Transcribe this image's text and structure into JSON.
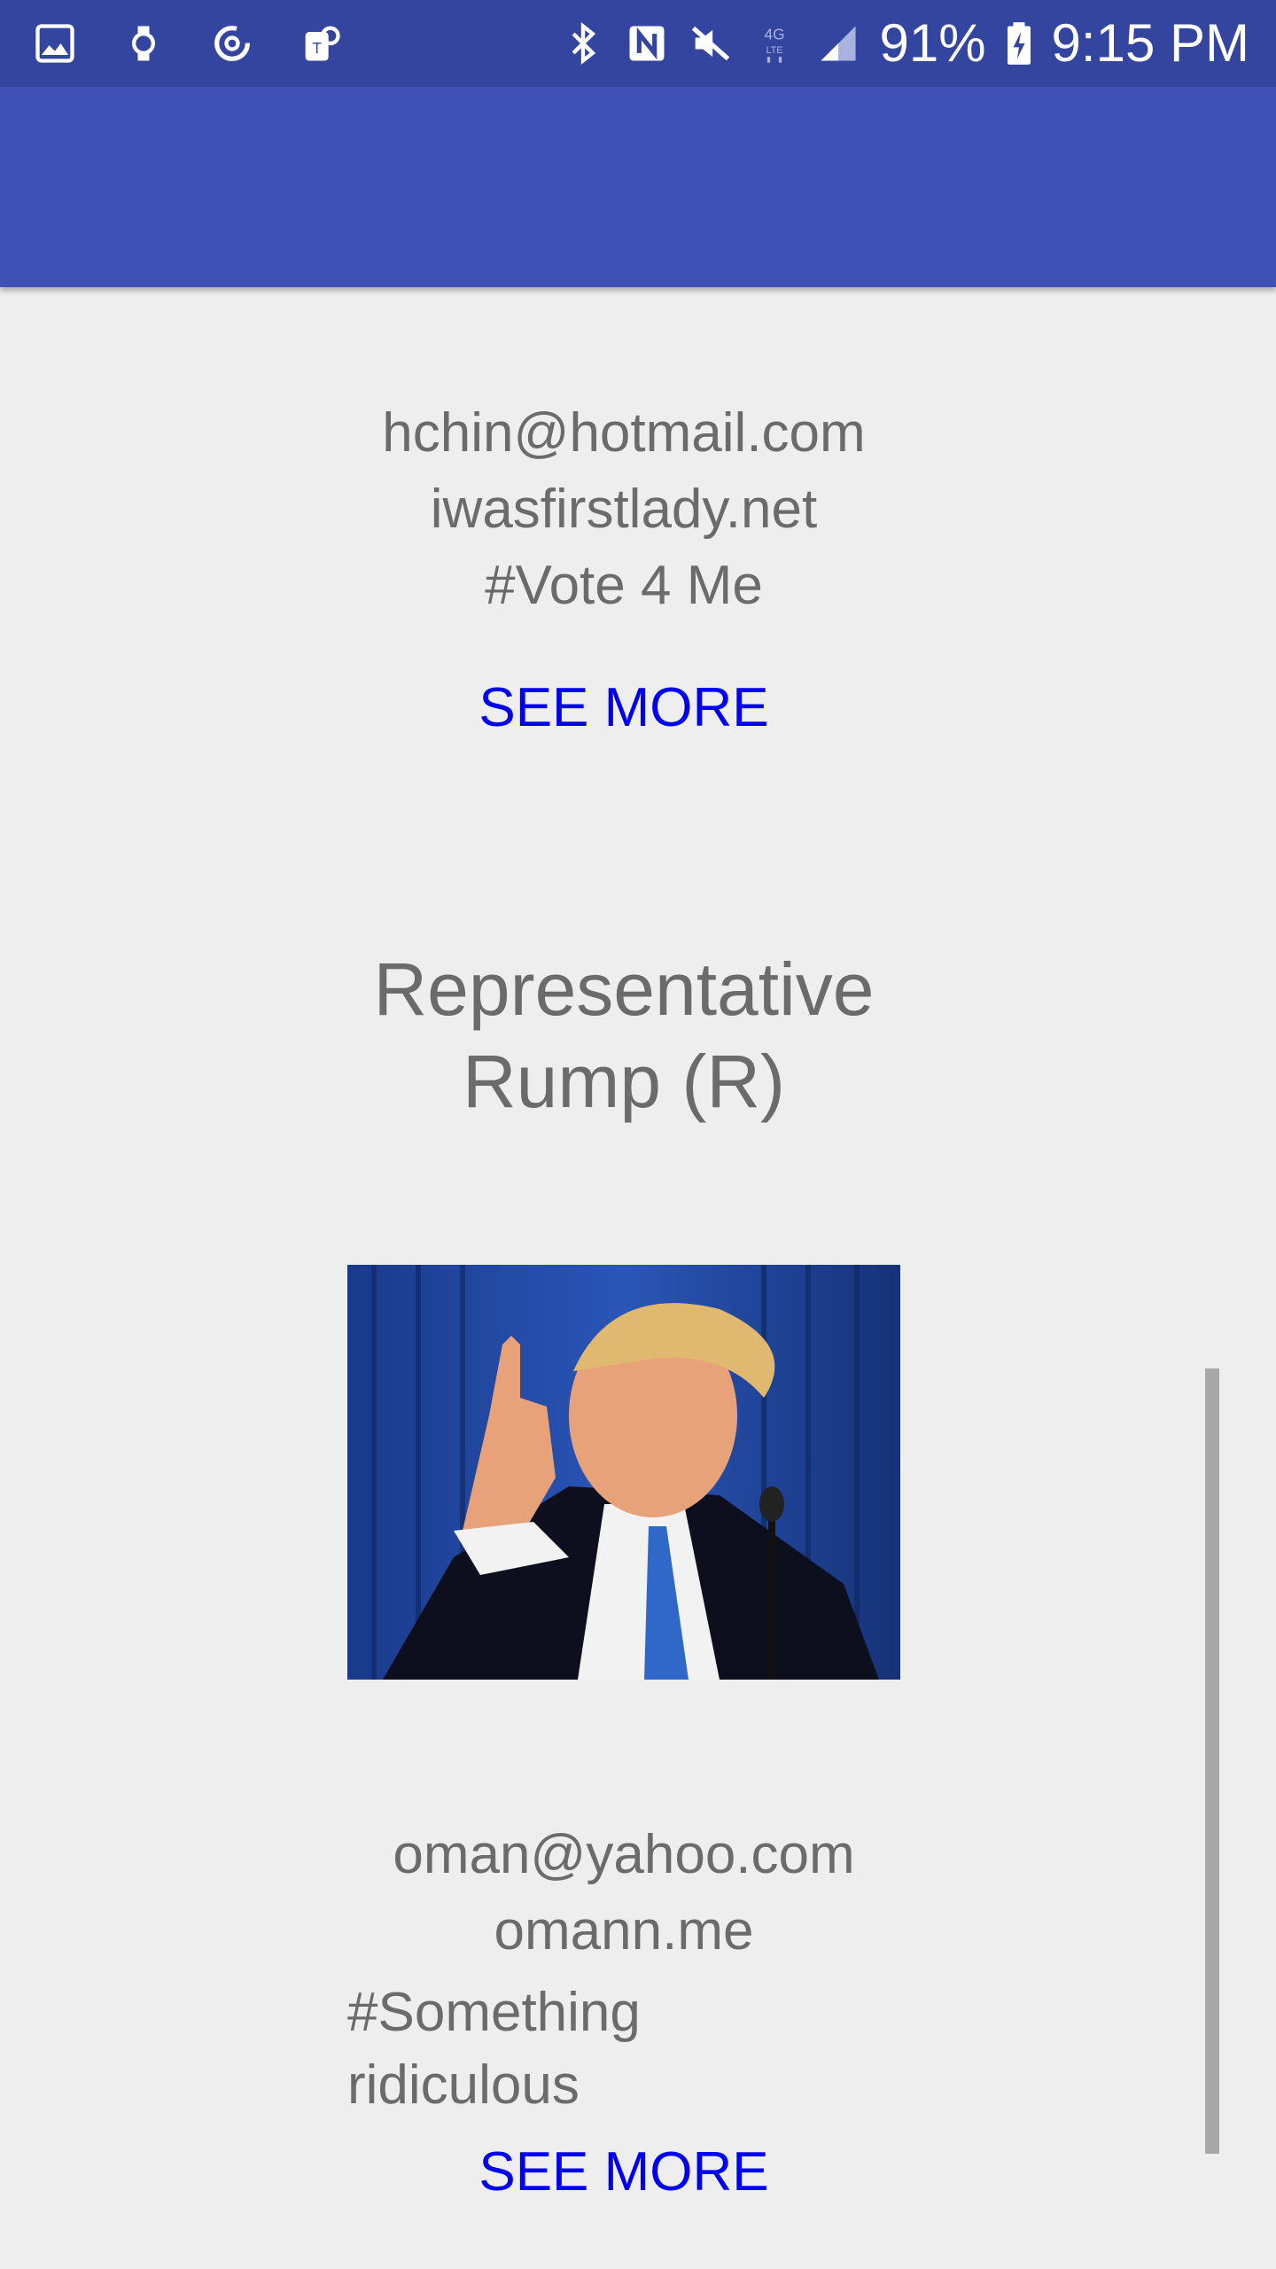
{
  "status_bar": {
    "left_icons": [
      "gallery-icon",
      "watch-icon",
      "sync-icon",
      "carrier-app-icon"
    ],
    "right_icons": [
      "bluetooth-icon",
      "nfc-icon",
      "mute-icon",
      "4g-lte-icon",
      "signal-icon",
      "battery-charging-icon"
    ],
    "battery": "91%",
    "time": "9:15 PM"
  },
  "colors": {
    "status_bar": "#3445a0",
    "app_bar": "#3f51b5",
    "background": "#eeeeee",
    "text": "#6b6b6b",
    "link": "#0000ee",
    "scrollbar": "#a8a8a8"
  },
  "entries": [
    {
      "email": "hchin@hotmail.com",
      "website": "iwasfirstlady.net",
      "hashtag": "#Vote 4 Me",
      "see_more": "SEE MORE"
    },
    {
      "name_line1": "Representative",
      "name_line2": "Rump (R)",
      "photo": "politician-photo",
      "email": "oman@yahoo.com",
      "website": "omann.me",
      "hashtag": "#Something ridiculous",
      "see_more": "SEE MORE"
    }
  ]
}
